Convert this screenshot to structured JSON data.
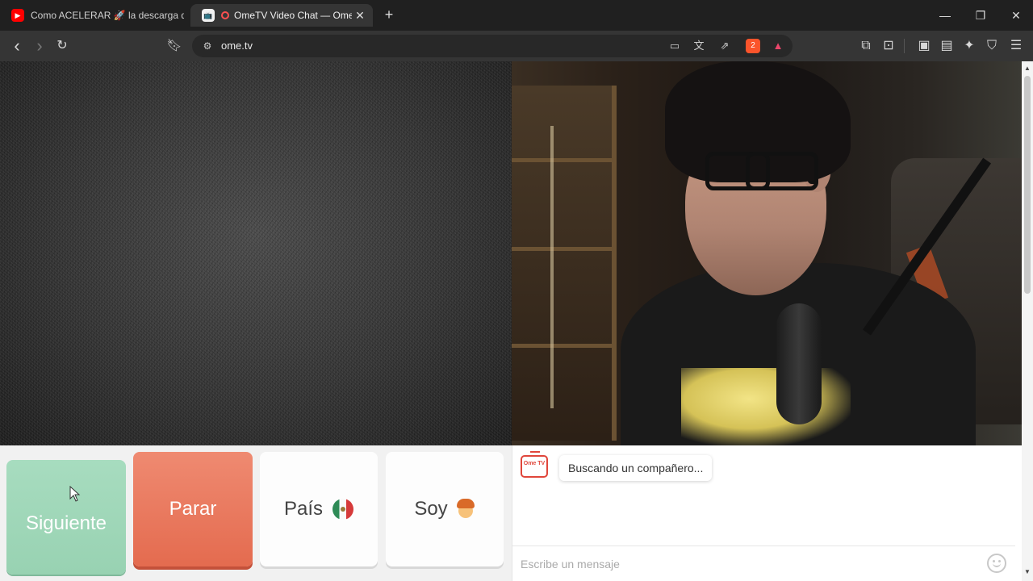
{
  "browser": {
    "tabs": [
      {
        "title": "Como ACELERAR 🚀 la descarga de",
        "favicon": "youtube-icon",
        "active": false
      },
      {
        "title": "OmeTV Video Chat — Omeg",
        "favicon": "ometv-icon",
        "recording": true,
        "active": true
      }
    ],
    "new_tab_symbol": "+",
    "window_controls": {
      "minimize": "—",
      "maximize": "❐",
      "close": "✕"
    },
    "url": "ome.tv",
    "shields_badge": "2",
    "nav": {
      "back": "‹",
      "forward": "›",
      "reload": "↻"
    }
  },
  "colors": {
    "next_button": "#98d2b2",
    "stop_button": "#e46b4f",
    "brand": "#e0463b"
  },
  "controls": {
    "next_label": "Siguiente",
    "stop_label": "Parar",
    "country_label": "País",
    "country_flag": "mexico-flag-icon",
    "gender_label": "Soy",
    "gender_icon": "boy-emoji-icon"
  },
  "chat": {
    "logo_text": "Ome TV",
    "status_message": "Buscando un compañero...",
    "input_placeholder": "Escribe un mensaje"
  }
}
